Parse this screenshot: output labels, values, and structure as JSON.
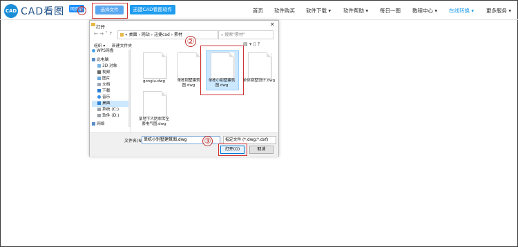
{
  "header": {
    "logo_icon": "CAD",
    "logo_text": "CAD看图",
    "web_badge": "网页版",
    "select_file_label": "选择文件",
    "cad_software_label": "迅捷CAD看图软件",
    "annotations": [
      "①",
      "②",
      "③"
    ],
    "nav": [
      {
        "label": "首页"
      },
      {
        "label": "软件购买"
      },
      {
        "label": "软件下载 ▾"
      },
      {
        "label": "软件帮助 ▾"
      },
      {
        "label": "每日一图"
      },
      {
        "label": "教程中心 ▾"
      },
      {
        "label": "在线转换 ▾"
      },
      {
        "label": "更多服务 ▾"
      }
    ]
  },
  "dialog": {
    "title": "打开",
    "close": "✕",
    "address": "« 桌面 › 网站 › 迅捷cad › 素材",
    "search_placeholder": "搜索\"素材\"",
    "toolbar": {
      "organize": "组织 ▾",
      "new_folder": "新建文件夹"
    },
    "sidebar": [
      {
        "label": "WPS网盘",
        "icon": "cloud-icon"
      },
      {
        "label": "此电脑",
        "icon": "computer-icon"
      },
      {
        "label": "3D 对象",
        "icon": "cube-icon"
      },
      {
        "label": "视频",
        "icon": "video-icon"
      },
      {
        "label": "图片",
        "icon": "picture-icon"
      },
      {
        "label": "文档",
        "icon": "document-icon"
      },
      {
        "label": "下载",
        "icon": "download-icon"
      },
      {
        "label": "音乐",
        "icon": "music-icon"
      },
      {
        "label": "桌面",
        "icon": "desktop-icon"
      },
      {
        "label": "系统 (C:)",
        "icon": "drive-icon"
      },
      {
        "label": "软件 (D:)",
        "icon": "drive-icon"
      },
      {
        "label": "网络",
        "icon": "network-icon"
      }
    ],
    "files": [
      {
        "name": "gongiu.dwg"
      },
      {
        "name": "单栋别墅建筑图.dwg"
      },
      {
        "name": "单栋小别墅建筑图.dwg"
      },
      {
        "name": "单体别墅设计.dwg"
      },
      {
        "name": "某地下人防车库全套电气图.dwg"
      }
    ],
    "filename_label": "文件名(N):",
    "filename_value": "单栋小别墅建筑图.dwg",
    "filetype_value": "指定文件 (*.dwg;*.dxf)",
    "open_label": "打开(O)",
    "cancel_label": "取消"
  },
  "colors": {
    "accent": "#1e9cef",
    "annotation": "#c0302e"
  }
}
